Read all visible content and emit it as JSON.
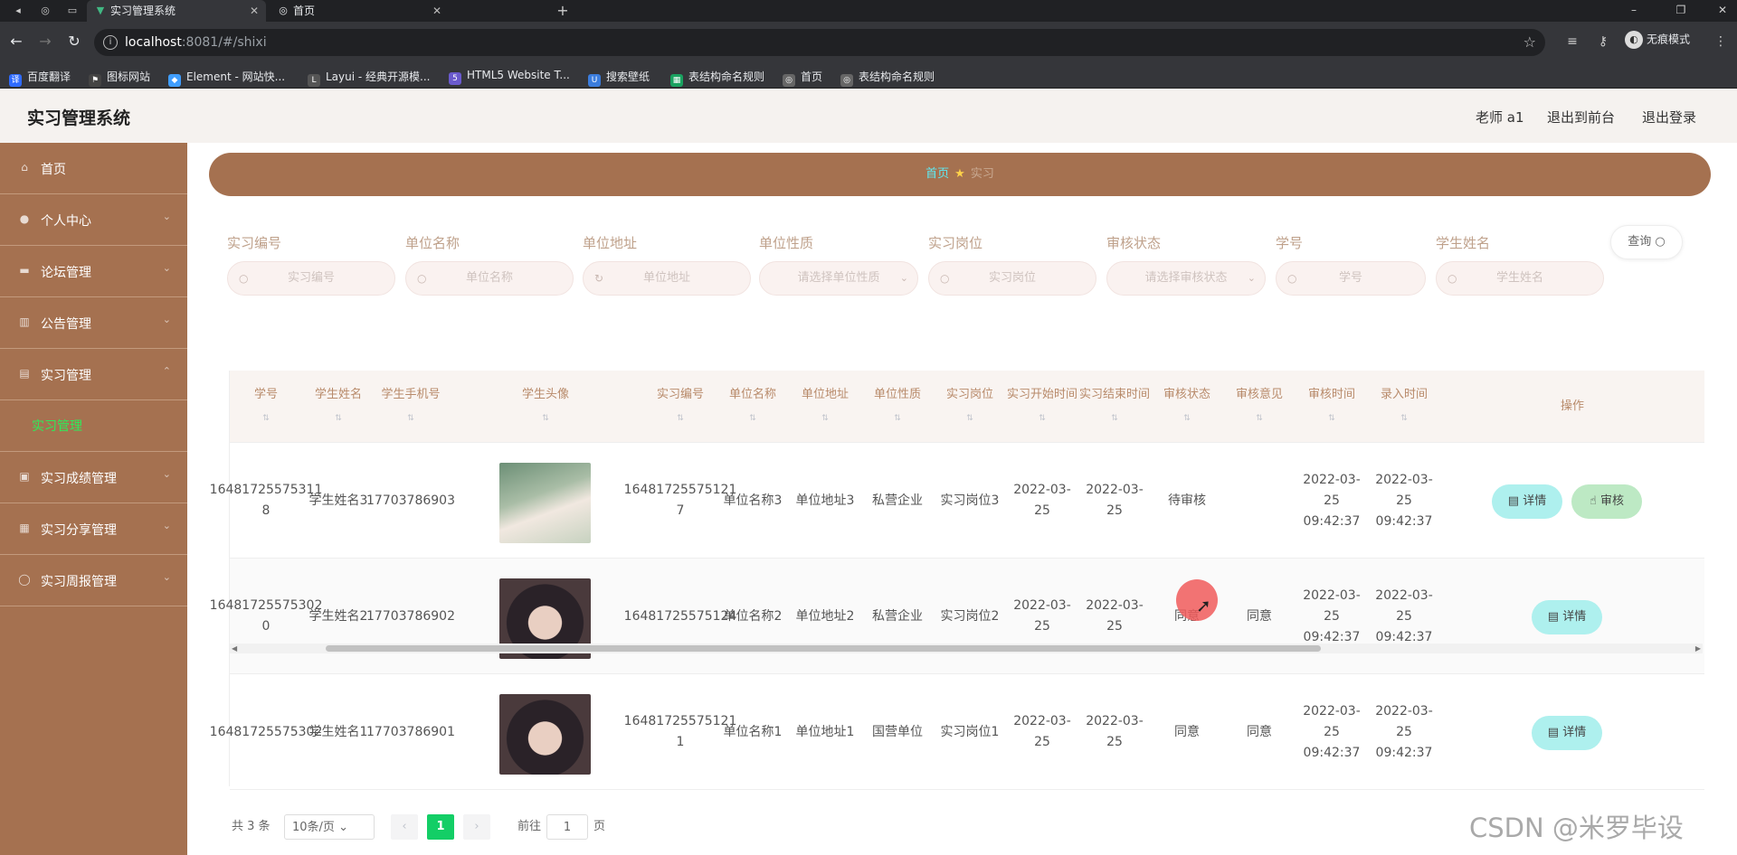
{
  "browser": {
    "tabs": [
      {
        "title": "实习管理系统",
        "icon": "vue-icon",
        "active": true
      },
      {
        "title": "首页",
        "icon": "globe-icon",
        "active": false
      }
    ],
    "url": {
      "host": "localhost",
      "path": ":8081/#/shixi"
    },
    "profile_label": "无痕模式",
    "bookmarks": [
      {
        "label": "百度翻译",
        "icon": "translate-icon",
        "color": "#2f6bff"
      },
      {
        "label": "图标网站",
        "icon": "flag-icon",
        "color": "#444444"
      },
      {
        "label": "Element - 网站快...",
        "icon": "element-icon",
        "color": "#409eff"
      },
      {
        "label": "Layui - 经典开源模...",
        "icon": "layui-icon",
        "color": "#555555"
      },
      {
        "label": "HTML5 Website T...",
        "icon": "html5-icon",
        "color": "#6a5acd"
      },
      {
        "label": "搜索壁纸",
        "icon": "wallpaper-icon",
        "color": "#3b7ddd"
      },
      {
        "label": "表结构命名规则",
        "icon": "sheet-icon",
        "color": "#1aa260"
      },
      {
        "label": "首页",
        "icon": "globe-icon",
        "color": "#666666"
      },
      {
        "label": "表结构命名规则",
        "icon": "globe-icon",
        "color": "#666666"
      }
    ]
  },
  "header": {
    "title": "实习管理系统",
    "user": "老师 a1",
    "back_to_front": "退出到前台",
    "logout": "退出登录"
  },
  "sidebar": {
    "items": [
      {
        "label": "首页",
        "icon": "home-icon"
      },
      {
        "label": "个人中心",
        "icon": "user-icon"
      },
      {
        "label": "论坛管理",
        "icon": "forum-icon"
      },
      {
        "label": "公告管理",
        "icon": "notice-icon"
      },
      {
        "label": "实习管理",
        "icon": "internship-icon"
      },
      {
        "label": "实习成绩管理",
        "icon": "score-icon"
      },
      {
        "label": "实习分享管理",
        "icon": "share-icon"
      },
      {
        "label": "实习周报管理",
        "icon": "report-icon"
      }
    ],
    "submenu": "实习管理"
  },
  "breadcrumb": {
    "home": "首页",
    "current": "实习"
  },
  "search": {
    "fields": [
      {
        "label": "实习编号",
        "placeholder": "实习编号"
      },
      {
        "label": "单位名称",
        "placeholder": "单位名称"
      },
      {
        "label": "单位地址",
        "placeholder": "单位地址"
      },
      {
        "label": "单位性质",
        "placeholder": "请选择单位性质"
      },
      {
        "label": "实习岗位",
        "placeholder": "实习岗位"
      },
      {
        "label": "审核状态",
        "placeholder": "请选择审核状态"
      },
      {
        "label": "学号",
        "placeholder": "学号"
      },
      {
        "label": "学生姓名",
        "placeholder": "学生姓名"
      }
    ],
    "query_label": "查询"
  },
  "table": {
    "headers": [
      "学号",
      "学生姓名",
      "学生手机号",
      "学生头像",
      "实习编号",
      "单位名称",
      "单位地址",
      "单位性质",
      "实习岗位",
      "实习开始时间",
      "实习结束时间",
      "审核状态",
      "审核意见",
      "审核时间",
      "录入时间",
      "操作"
    ],
    "rows": [
      {
        "student_id": "16481725575311 8",
        "name": "学生姓名3",
        "phone": "17703786903",
        "avatar": "avatar-photo-1",
        "intern_id": "16481725575121 7",
        "company": "单位名称3",
        "address": "单位地址3",
        "nature": "私营企业",
        "post": "实习岗位3",
        "start": "2022-03-25",
        "end": "2022-03-25",
        "status": "待审核",
        "opinion": "",
        "audit_time": "2022-03-25 09:42:37",
        "entry_time": "2022-03-25 09:42:37"
      },
      {
        "student_id": "16481725575302 0",
        "name": "学生姓名2",
        "phone": "17703786902",
        "avatar": "avatar-photo-2",
        "intern_id": "16481725575124",
        "company": "单位名称2",
        "address": "单位地址2",
        "nature": "私营企业",
        "post": "实习岗位2",
        "start": "2022-03-25",
        "end": "2022-03-25",
        "status": "同意",
        "opinion": "同意",
        "audit_time": "2022-03-25 09:42:37",
        "entry_time": "2022-03-25 09:42:37"
      },
      {
        "student_id": "16481725575302",
        "name": "学生姓名1",
        "phone": "17703786901",
        "avatar": "avatar-photo-2",
        "intern_id": "16481725575121 1",
        "company": "单位名称1",
        "address": "单位地址1",
        "nature": "国营单位",
        "post": "实习岗位1",
        "start": "2022-03-25",
        "end": "2022-03-25",
        "status": "同意",
        "opinion": "同意",
        "audit_time": "2022-03-25 09:42:37",
        "entry_time": "2022-03-25 09:42:37"
      }
    ],
    "detail_label": "详情",
    "audit_label": "审核"
  },
  "pagination": {
    "total": "共 3 条",
    "page_size": "10条/页",
    "current_page": "1",
    "goto_prefix": "前往",
    "goto_value": "1",
    "goto_suffix": "页"
  },
  "watermark": "CSDN @米罗毕设",
  "colors": {
    "sidebar": "#a57150",
    "accent": "#13ce66",
    "submenu_active": "#2eeb5a"
  }
}
